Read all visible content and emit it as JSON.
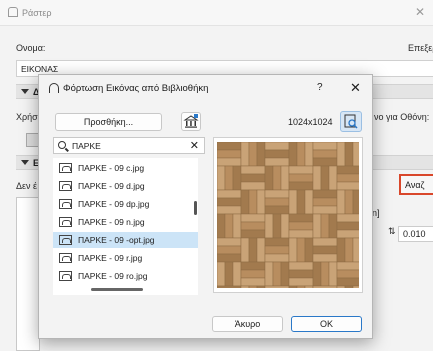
{
  "background": {
    "title": "Ράστερ",
    "name_label": "Ονομα:",
    "right_label": "Επεξερ",
    "name_value": "ΕΙΚΟΝΑΣ",
    "section1_label": "Δ",
    "use_label": "Χρήσ",
    "screen_label": "νο για Οθόνη:",
    "section2_label": "Ε",
    "notfound_label": "Δεν έ",
    "browse_button": "Αναζ",
    "bracket_label": "n]",
    "spin_value": "0.010"
  },
  "dialog": {
    "title": "Φόρτωση Εικόνας από Βιβλιοθήκη",
    "help": "?",
    "close": "✕",
    "add_button": "Προσθήκη...",
    "image_size": "1024x1024",
    "search_value": "ΠΑΡΚΕ",
    "files": [
      {
        "name": "ΠΑΡΚΕ - 09 c.jpg",
        "selected": false
      },
      {
        "name": "ΠΑΡΚΕ - 09 d.jpg",
        "selected": false
      },
      {
        "name": "ΠΑΡΚΕ - 09 dp.jpg",
        "selected": false
      },
      {
        "name": "ΠΑΡΚΕ - 09 n.jpg",
        "selected": false
      },
      {
        "name": "ΠΑΡΚΕ - 09 -opt.jpg",
        "selected": true
      },
      {
        "name": "ΠΑΡΚΕ - 09 r.jpg",
        "selected": false
      },
      {
        "name": "ΠΑΡΚΕ - 09 ro.jpg",
        "selected": false
      }
    ],
    "cancel_button": "Άκυρο",
    "ok_button": "OK"
  },
  "colors": {
    "accent_selection": "#cce4f7",
    "ok_border": "#2a78c8",
    "highlight_red": "#d9472b",
    "wood_light": "#c9a377",
    "wood_dark": "#a27a4e"
  }
}
